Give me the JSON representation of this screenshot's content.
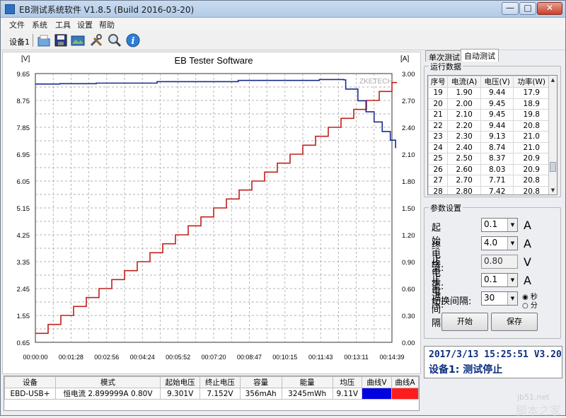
{
  "window": {
    "title": "EB测试系统软件 V1.8.5 (Build 2016-03-20)",
    "min": "—",
    "max": "□",
    "close": "✕"
  },
  "menu": [
    "文件",
    "系统",
    "工具",
    "设置",
    "帮助"
  ],
  "toolbar": {
    "device": "设备1",
    "icons": [
      "folder-icon",
      "save-icon",
      "screenshot-icon",
      "tools-icon",
      "search-icon",
      "info-icon"
    ]
  },
  "chart_data": {
    "type": "line",
    "title": "EB Tester Software",
    "watermark": "ZKETECH",
    "y_left_unit": "[V]",
    "y_right_unit": "[A]",
    "y_left_ticks": [
      "9.65",
      "8.75",
      "7.85",
      "6.95",
      "6.05",
      "5.15",
      "4.25",
      "3.35",
      "2.45",
      "1.55",
      "0.65"
    ],
    "y_right_ticks": [
      "3.00",
      "2.70",
      "2.40",
      "2.10",
      "1.80",
      "1.50",
      "1.20",
      "0.90",
      "0.60",
      "0.30",
      "0.00"
    ],
    "x_ticks": [
      "00:00:00",
      "00:01:28",
      "00:02:56",
      "00:04:24",
      "00:05:52",
      "00:07:20",
      "00:08:47",
      "00:10:15",
      "00:11:43",
      "00:13:11",
      "00:14:39"
    ],
    "ylim_left": [
      0.65,
      9.65
    ],
    "ylim_right": [
      0,
      3.0
    ],
    "xlim_seconds": [
      0,
      879
    ],
    "grid": true,
    "series": [
      {
        "color": "#1a2d8c",
        "axis": "left",
        "points": [
          [
            0,
            9.3
          ],
          [
            60,
            9.31
          ],
          [
            150,
            9.33
          ],
          [
            300,
            9.38
          ],
          [
            500,
            9.42
          ],
          [
            700,
            9.45
          ],
          [
            760,
            9.44
          ],
          [
            765,
            9.13
          ],
          [
            795,
            8.74
          ],
          [
            815,
            8.37
          ],
          [
            835,
            8.03
          ],
          [
            855,
            7.71
          ],
          [
            875,
            7.42
          ],
          [
            888,
            7.15
          ]
        ]
      },
      {
        "color": "#c0201c",
        "axis": "right",
        "points": [
          [
            0,
            0.1
          ],
          [
            879,
            2.9
          ]
        ]
      }
    ]
  },
  "data_panel": {
    "headers": [
      "设备",
      "模式",
      "起始电压",
      "终止电压",
      "容量",
      "能量",
      "均压",
      "曲线V",
      "曲线A"
    ],
    "row": [
      "EBD-USB+",
      "恒电流 2.899999A 0.80V",
      "9.301V",
      "7.152V",
      "356mAh",
      "3245mWh",
      "9.11V",
      "",
      ""
    ],
    "curve_v_color": "#0000e0",
    "curve_a_color": "#ff1c1c"
  },
  "tabs": [
    "单次测试",
    "自动测试"
  ],
  "run_data": {
    "title": "运行数据",
    "headers": [
      "序号",
      "电流(A)",
      "电压(V)",
      "功率(W)"
    ],
    "rows": [
      [
        "19",
        "1.90",
        "9.44",
        "17.9"
      ],
      [
        "20",
        "2.00",
        "9.45",
        "18.9"
      ],
      [
        "21",
        "2.10",
        "9.45",
        "19.8"
      ],
      [
        "22",
        "2.20",
        "9.44",
        "20.8"
      ],
      [
        "23",
        "2.30",
        "9.13",
        "21.0"
      ],
      [
        "24",
        "2.40",
        "8.74",
        "21.0"
      ],
      [
        "25",
        "2.50",
        "8.37",
        "20.9"
      ],
      [
        "26",
        "2.60",
        "8.03",
        "20.9"
      ],
      [
        "27",
        "2.70",
        "7.71",
        "20.8"
      ],
      [
        "28",
        "2.80",
        "7.42",
        "20.8"
      ]
    ]
  },
  "params": {
    "title": "参数设置",
    "start_current": {
      "label": "起始电流:",
      "value": "0.1",
      "unit": "A"
    },
    "end_current": {
      "label": "终止电流:",
      "value": "4.0",
      "unit": "A"
    },
    "end_voltage": {
      "label": "终止电压:",
      "value": "0.80",
      "unit": "V"
    },
    "step": {
      "label": "步进间隔:",
      "value": "0.1",
      "unit": "A"
    },
    "switch": {
      "label": "切换间隔:",
      "value": "30",
      "sec": "秒",
      "min": "分"
    },
    "start_btn": "开始",
    "save_btn": "保存"
  },
  "status": {
    "line1": "2017/3/13 15:25:51  V3.20",
    "line2": "设备1: 测试停止"
  },
  "watermark": {
    "site": "jb51.net",
    "brand": "脚本之家"
  }
}
